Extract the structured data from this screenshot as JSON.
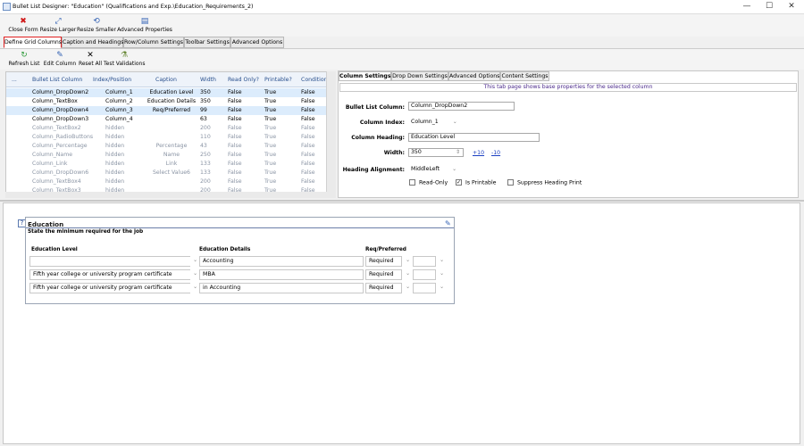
{
  "window": {
    "title": "Bullet List Designer: \"Education\" (Qualifications and Exp.\\Education_Requirements_2)",
    "minimize": "—",
    "maximize": "☐",
    "close": "✕"
  },
  "toolbar1": [
    {
      "label": "Close Form",
      "icon": "close-icon"
    },
    {
      "label": "Resize Larger",
      "icon": "resize-larger-icon"
    },
    {
      "label": "Resize Smaller",
      "icon": "resize-smaller-icon"
    },
    {
      "label": "Advanced Properties",
      "icon": "properties-icon"
    }
  ],
  "tabs": [
    "Define Grid Columns",
    "Caption and Headings",
    "Row/Column Settings",
    "Toolbar Settings",
    "Advanced Options"
  ],
  "toolbar2": [
    {
      "label": "Refresh List",
      "icon": "refresh-icon"
    },
    {
      "label": "Edit Column",
      "icon": "pencil-icon"
    },
    {
      "label": "Reset All",
      "icon": "x-icon"
    },
    {
      "label": "Test Validations",
      "icon": "test-icon"
    }
  ],
  "grid": {
    "headers": [
      "...",
      "Bullet List Column",
      "Index/Position",
      "Caption",
      "Width",
      "Read Only?",
      "Printable?",
      "Conditional?"
    ],
    "rows": [
      {
        "col": "Column_DropDown2",
        "idx": "Column_1",
        "cap": "Education Level",
        "w": "350",
        "ro": "False",
        "pr": "True",
        "cond": "False",
        "state": "selected"
      },
      {
        "col": "Column_TextBox",
        "idx": "Column_2",
        "cap": "Education Details",
        "w": "350",
        "ro": "False",
        "pr": "True",
        "cond": "False",
        "state": "normal"
      },
      {
        "col": "Column_DropDown4",
        "idx": "Column_3",
        "cap": "Req/Preferred",
        "w": "99",
        "ro": "False",
        "pr": "True",
        "cond": "False",
        "state": "selected"
      },
      {
        "col": "Column_DropDown3",
        "idx": "Column_4",
        "cap": "",
        "w": "63",
        "ro": "False",
        "pr": "True",
        "cond": "False",
        "state": "normal"
      },
      {
        "col": "Column_TextBox2",
        "idx": "hidden",
        "cap": "",
        "w": "200",
        "ro": "False",
        "pr": "True",
        "cond": "False",
        "state": "hidden"
      },
      {
        "col": "Column_RadioButtons",
        "idx": "hidden",
        "cap": "",
        "w": "110",
        "ro": "False",
        "pr": "True",
        "cond": "False",
        "state": "hidden"
      },
      {
        "col": "Column_Percentage",
        "idx": "hidden",
        "cap": "Percentage",
        "w": "43",
        "ro": "False",
        "pr": "True",
        "cond": "False",
        "state": "hidden"
      },
      {
        "col": "Column_Name",
        "idx": "hidden",
        "cap": "Name",
        "w": "250",
        "ro": "False",
        "pr": "True",
        "cond": "False",
        "state": "hidden"
      },
      {
        "col": "Column_Link",
        "idx": "hidden",
        "cap": "Link",
        "w": "133",
        "ro": "False",
        "pr": "True",
        "cond": "False",
        "state": "hidden"
      },
      {
        "col": "Column_DropDown6",
        "idx": "hidden",
        "cap": "Select Value6",
        "w": "133",
        "ro": "False",
        "pr": "True",
        "cond": "False",
        "state": "hidden"
      },
      {
        "col": "Column_TextBox4",
        "idx": "hidden",
        "cap": "",
        "w": "200",
        "ro": "False",
        "pr": "True",
        "cond": "False",
        "state": "hidden"
      },
      {
        "col": "Column_TextBox3",
        "idx": "hidden",
        "cap": "",
        "w": "200",
        "ro": "False",
        "pr": "True",
        "cond": "False",
        "state": "hidden"
      }
    ]
  },
  "right": {
    "tabs": [
      "Column Settings",
      "Drop Down Settings",
      "Advanced Options",
      "Content Settings"
    ],
    "info": "This tab page shows base properties for the selected column",
    "bullet_list_column_label": "Bullet List Column:",
    "bullet_list_column": "Column_DropDown2",
    "column_index_label": "Column Index:",
    "column_index": "Column_1",
    "column_heading_label": "Column Heading:",
    "column_heading": "Education Level",
    "width_label": "Width:",
    "width": "350",
    "plus10": "+10",
    "minus10": "-10",
    "heading_alignment_label": "Heading Alignment:",
    "heading_alignment": "MiddleLeft",
    "read_only": "Read-Only",
    "is_printable": "Is Printable",
    "suppress": "Suppress Heading Print"
  },
  "preview": {
    "help": "?",
    "title": "Education",
    "subtitle": "State the minimum required for the job",
    "headers": [
      "Education Level",
      "Education Details",
      "Req/Preferred"
    ],
    "rows": [
      {
        "level": "",
        "details": "Accounting",
        "req": "Required"
      },
      {
        "level": "Fifth year college or university program certificate",
        "details": "MBA",
        "req": "Required"
      },
      {
        "level": "Fifth year college or university program certificate",
        "details": "in Accounting",
        "req": "Required"
      }
    ]
  }
}
